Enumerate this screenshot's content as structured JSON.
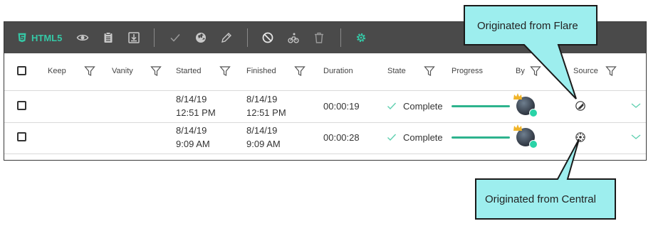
{
  "toolbar": {
    "html5_label": "HTML5",
    "icons": [
      "html5-icon",
      "eye-icon",
      "clipboard-icon",
      "download-icon",
      "check-icon",
      "globe-upload-icon",
      "pencil-icon",
      "cancel-icon",
      "cyclist-icon",
      "trash-icon",
      "gear-icon"
    ],
    "accent": "#35c8a6",
    "background": "#4a4a4a"
  },
  "columns": {
    "keep": "Keep",
    "vanity": "Vanity",
    "started": "Started",
    "finished": "Finished",
    "duration": "Duration",
    "state": "State",
    "progress": "Progress",
    "by": "By",
    "source": "Source"
  },
  "rows": [
    {
      "started_date": "8/14/19",
      "started_time": "12:51 PM",
      "finished_date": "8/14/19",
      "finished_time": "12:51 PM",
      "duration": "00:00:19",
      "state": "Complete",
      "progress": 1.0,
      "source_icon": "flare-icon"
    },
    {
      "started_date": "8/14/19",
      "started_time": "9:09 AM",
      "finished_date": "8/14/19",
      "finished_time": "9:09 AM",
      "duration": "00:00:28",
      "state": "Complete",
      "progress": 1.0,
      "source_icon": "central-icon"
    }
  ],
  "callouts": {
    "flare": "Originated from Flare",
    "central": "Originated from Central",
    "fill": "#9deeee"
  },
  "colors": {
    "progress": "#2db38d",
    "check": "#5fd0b0"
  }
}
